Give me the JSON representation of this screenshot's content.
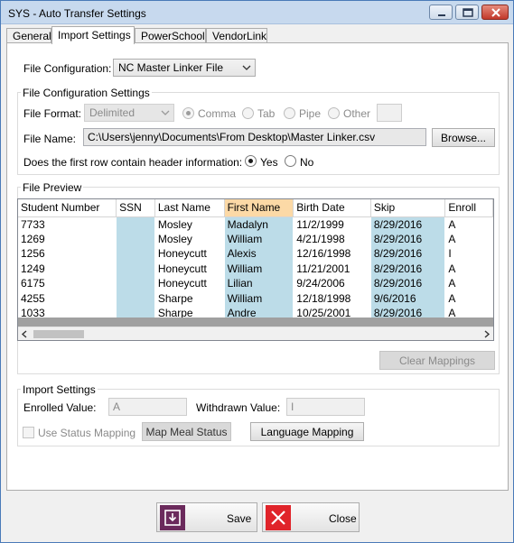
{
  "window": {
    "title": "SYS - Auto Transfer Settings"
  },
  "tabs": [
    {
      "label": "General"
    },
    {
      "label": "Import Settings"
    },
    {
      "label": "PowerSchool"
    },
    {
      "label": "VendorLink"
    }
  ],
  "file_configuration": {
    "label": "File Configuration:",
    "value": "NC Master Linker File"
  },
  "file_config_settings": {
    "group_title": "File Configuration Settings",
    "format_label": "File Format:",
    "format_value": "Delimited",
    "delimiters": [
      "Comma",
      "Tab",
      "Pipe",
      "Other"
    ],
    "selected_delimiter": "Comma",
    "other_value": "",
    "file_name_label": "File Name:",
    "file_name_value": "C:\\Users\\jenny\\Documents\\From Desktop\\Master Linker.csv",
    "browse_label": "Browse...",
    "header_question": "Does the first row contain header information:",
    "header_yes": "Yes",
    "header_no": "No",
    "header_selected": "Yes"
  },
  "file_preview": {
    "group_title": "File Preview",
    "columns": [
      "Student Number",
      "SSN",
      "Last Name",
      "First Name",
      "Birth Date",
      "Skip",
      "Enroll"
    ],
    "selected_column": "First Name",
    "rows": [
      [
        "7733",
        "",
        "Mosley",
        "Madalyn",
        "11/2/1999",
        "8/29/2016",
        "A"
      ],
      [
        "1269",
        "",
        "Mosley",
        "William",
        "4/21/1998",
        "8/29/2016",
        "A"
      ],
      [
        "1256",
        "",
        "Honeycutt",
        "Alexis",
        "12/16/1998",
        "8/29/2016",
        "I"
      ],
      [
        "1249",
        "",
        "Honeycutt",
        "William",
        "11/21/2001",
        "8/29/2016",
        "A"
      ],
      [
        "6175",
        "",
        "Honeycutt",
        "Lilian",
        "9/24/2006",
        "8/29/2016",
        "A"
      ],
      [
        "4255",
        "",
        "Sharpe",
        "William",
        "12/18/1998",
        "9/6/2016",
        "A"
      ],
      [
        "1033",
        "",
        "Sharpe",
        "Andre",
        "10/25/2001",
        "8/29/2016",
        "A"
      ]
    ],
    "clear_mappings_label": "Clear Mappings"
  },
  "import_settings": {
    "group_title": "Import Settings",
    "enrolled_label": "Enrolled Value:",
    "enrolled_value": "A",
    "withdrawn_label": "Withdrawn Value:",
    "withdrawn_value": "I",
    "use_status_mapping_label": "Use Status Mapping",
    "map_meal_status_label": "Map Meal Status",
    "language_mapping_label": "Language Mapping"
  },
  "footer": {
    "save_label": "Save",
    "close_label": "Close"
  },
  "colors": {
    "title_bar": "#c7d9ee",
    "highlight_column": "#bcdce8",
    "selected_header": "#fcd9a6",
    "save_icon": "#6b2a5c",
    "close_icon": "#e0242a"
  }
}
